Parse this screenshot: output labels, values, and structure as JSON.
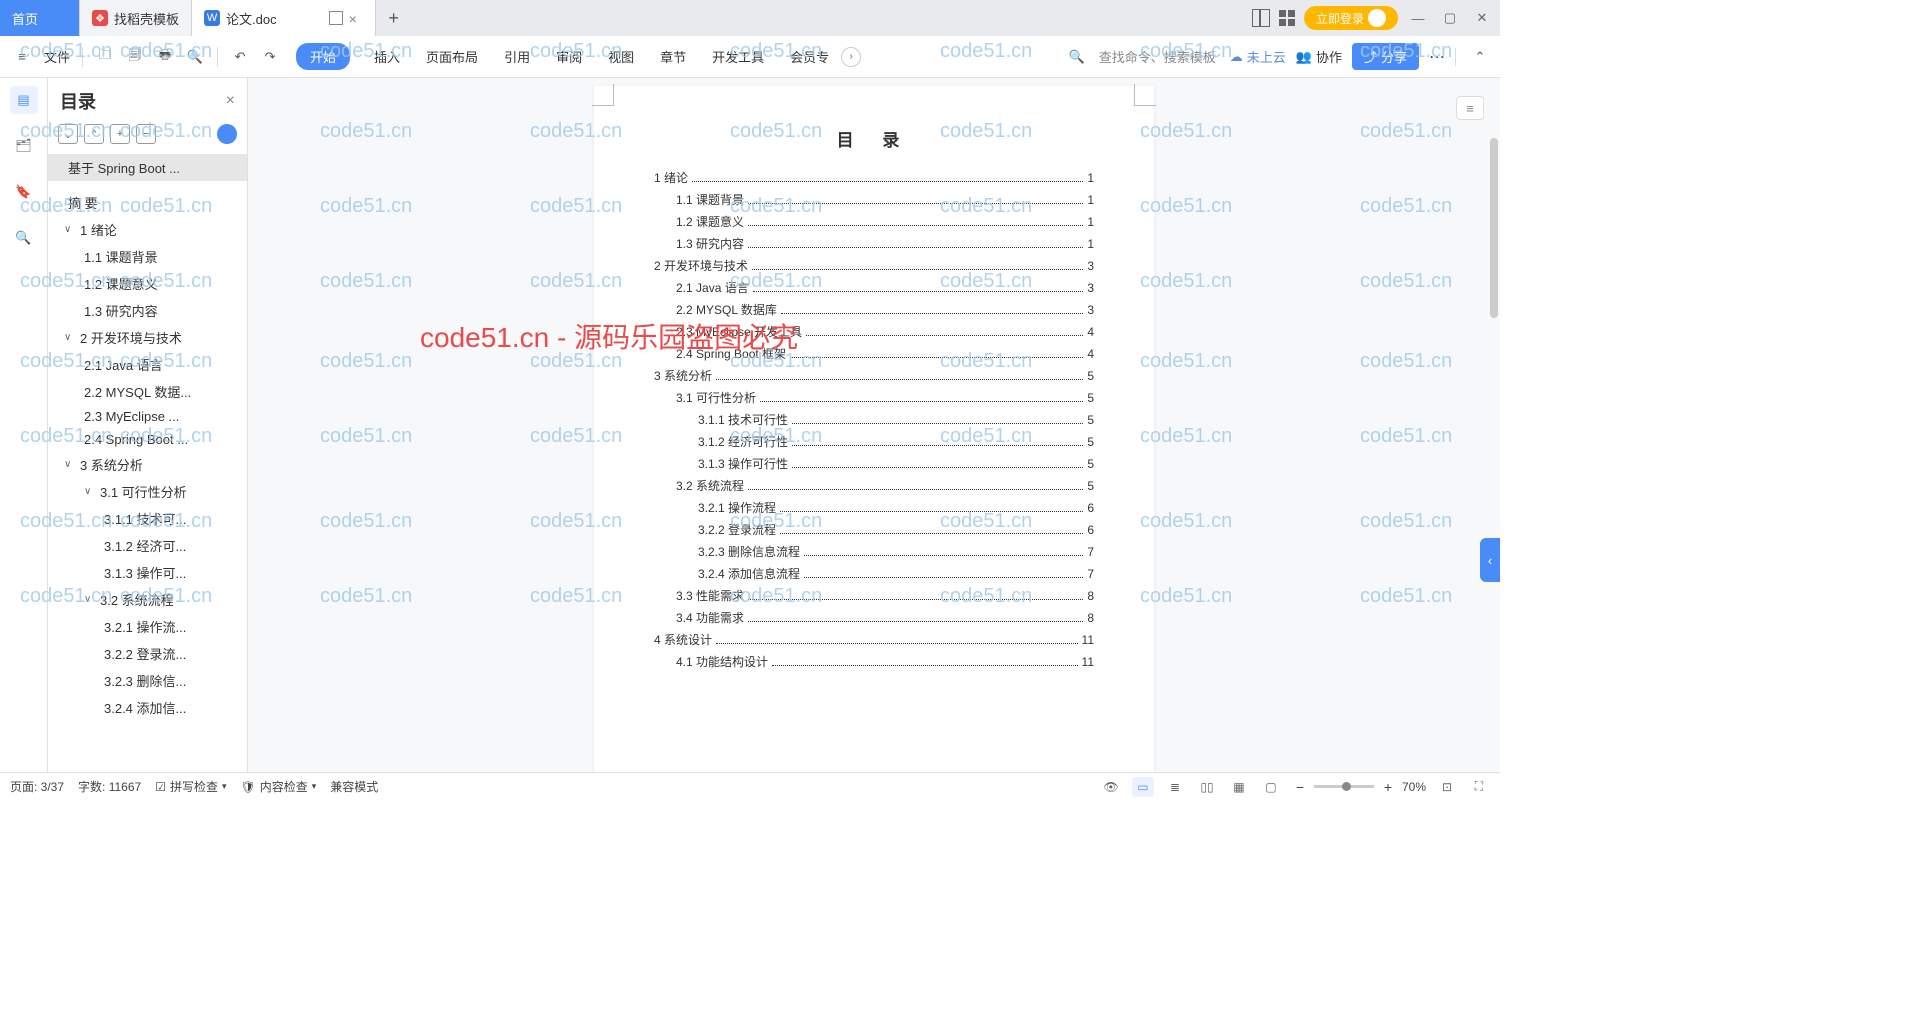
{
  "tabs": {
    "home": "首页",
    "template": "找稻壳模板",
    "doc": "论文.doc"
  },
  "login_button": "立即登录",
  "toolbar": {
    "file": "文件",
    "menus": [
      "开始",
      "插入",
      "页面布局",
      "引用",
      "审阅",
      "视图",
      "章节",
      "开发工具",
      "会员专"
    ],
    "search_cmd": "查找命令、搜索模板",
    "cloud": "未上云",
    "collab": "协作",
    "share": "分享"
  },
  "outline": {
    "title": "目录",
    "root": "基于 Spring Boot ...",
    "abstract": "摘  要",
    "items": [
      {
        "lv": 1,
        "chev": "∨",
        "t": "1  绪论"
      },
      {
        "lv": 2,
        "t": "1.1  课题背景"
      },
      {
        "lv": 2,
        "t": "1.2  课题意义"
      },
      {
        "lv": 2,
        "t": "1.3  研究内容"
      },
      {
        "lv": 1,
        "chev": "∨",
        "t": "2  开发环境与技术"
      },
      {
        "lv": 2,
        "t": "2.1 Java 语言"
      },
      {
        "lv": 2,
        "t": "2.2 MYSQL 数据..."
      },
      {
        "lv": 2,
        "t": "2.3 MyEclipse ..."
      },
      {
        "lv": 2,
        "t": "2.4 Spring Boot ..."
      },
      {
        "lv": 1,
        "chev": "∨",
        "t": "3  系统分析"
      },
      {
        "lv": 3,
        "chev": "∨",
        "t": "3.1  可行性分析"
      },
      {
        "lv": 4,
        "t": "3.1.1  技术可..."
      },
      {
        "lv": 4,
        "t": "3.1.2  经济可..."
      },
      {
        "lv": 4,
        "t": "3.1.3  操作可..."
      },
      {
        "lv": 3,
        "chev": "∨",
        "t": "3.2  系统流程"
      },
      {
        "lv": 4,
        "t": "3.2.1  操作流..."
      },
      {
        "lv": 4,
        "t": "3.2.2  登录流..."
      },
      {
        "lv": 4,
        "t": "3.2.3  删除信..."
      },
      {
        "lv": 4,
        "t": "3.2.4  添加信..."
      }
    ]
  },
  "document": {
    "toc_heading": "目  录",
    "entries": [
      {
        "lv": 1,
        "t": "1  绪论",
        "p": "1"
      },
      {
        "lv": 2,
        "t": "1.1 课题背景",
        "p": "1"
      },
      {
        "lv": 2,
        "t": "1.2 课题意义",
        "p": "1"
      },
      {
        "lv": 2,
        "t": "1.3 研究内容",
        "p": "1"
      },
      {
        "lv": 1,
        "t": "2  开发环境与技术",
        "p": "3"
      },
      {
        "lv": 2,
        "t": "2.1 Java 语言",
        "p": "3"
      },
      {
        "lv": 2,
        "t": "2.2 MYSQL 数据库",
        "p": "3"
      },
      {
        "lv": 2,
        "t": "2.3 MyEclipse 开发工具",
        "p": "4"
      },
      {
        "lv": 2,
        "t": "2.4 Spring Boot 框架",
        "p": "4"
      },
      {
        "lv": 1,
        "t": "3  系统分析",
        "p": "5"
      },
      {
        "lv": 2,
        "t": "3.1 可行性分析",
        "p": "5"
      },
      {
        "lv": 3,
        "t": "3.1.1  技术可行性",
        "p": "5"
      },
      {
        "lv": 3,
        "t": "3.1.2  经济可行性",
        "p": "5"
      },
      {
        "lv": 3,
        "t": "3.1.3  操作可行性",
        "p": "5"
      },
      {
        "lv": 2,
        "t": "3.2 系统流程",
        "p": "5"
      },
      {
        "lv": 3,
        "t": "3.2.1  操作流程",
        "p": "6"
      },
      {
        "lv": 3,
        "t": "3.2.2  登录流程",
        "p": "6"
      },
      {
        "lv": 3,
        "t": "3.2.3  删除信息流程",
        "p": "7"
      },
      {
        "lv": 3,
        "t": "3.2.4  添加信息流程",
        "p": "7"
      },
      {
        "lv": 2,
        "t": "3.3 性能需求",
        "p": "8"
      },
      {
        "lv": 2,
        "t": "3.4 功能需求",
        "p": "8"
      },
      {
        "lv": 1,
        "t": "4  系统设计",
        "p": "11"
      },
      {
        "lv": 2,
        "t": "4.1 功能结构设计",
        "p": "11"
      }
    ]
  },
  "watermark": {
    "small": "code51.cn",
    "big": "code51.cn - 源码乐园盗图必究"
  },
  "statusbar": {
    "page": "页面: 3/37",
    "words": "字数: 11667",
    "spell": "拼写检查",
    "content": "内容检查",
    "compat": "兼容模式",
    "zoom": "70%"
  }
}
